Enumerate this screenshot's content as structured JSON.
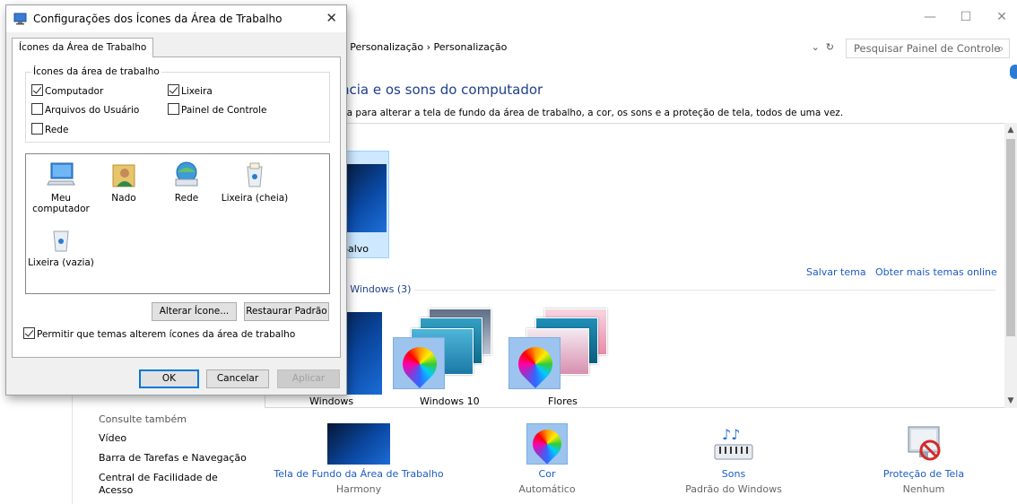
{
  "control_panel": {
    "breadcrumb_tail": "e Personalização  ›  Personalização",
    "search_placeholder": "Pesquisar Painel de Controle",
    "heading": "ncia e os sons do computador",
    "description": "na para alterar a tela de fundo da área de trabalho, a cor, os sons e a proteção de tela, todos de uma vez.",
    "saved_theme_label": "Salvo",
    "save_theme_link": "Salvar tema",
    "more_themes_link": "Obter mais temas online",
    "windows_section_label": "o Windows (3)",
    "themes": [
      "Windows",
      "Windows 10",
      "Flores"
    ],
    "see_also": {
      "title": "Consulte também",
      "items": [
        "Vídeo",
        "Barra de Tarefas e Navegação",
        "Central de Facilidade de",
        "Acesso"
      ]
    },
    "bottom_items": [
      {
        "title": "Tela de Fundo da Área de Trabalho",
        "subtitle": "Harmony"
      },
      {
        "title": "Cor",
        "subtitle": "Automático"
      },
      {
        "title": "Sons",
        "subtitle": "Padrão do Windows"
      },
      {
        "title": "Proteção de Tela",
        "subtitle": "Nenhum"
      }
    ]
  },
  "dialog": {
    "title": "Configurações dos Ícones da Área de Trabalho",
    "tab_label": "Ícones da Área de Trabalho",
    "group_label": "Ícones da área de trabalho",
    "checkboxes": {
      "computador": "Computador",
      "lixeira": "Lixeira",
      "arquivos_usuario": "Arquivos do Usuário",
      "painel_controle": "Painel de Controle",
      "rede": "Rede"
    },
    "icons": {
      "meu_computador_line1": "Meu",
      "meu_computador_line2": "computador",
      "nado": "Nado",
      "rede": "Rede",
      "lixeira_cheia": "Lixeira (cheia)",
      "lixeira_vazia": "Lixeira (vazia)"
    },
    "change_icon_button": "Alterar Ícone...",
    "restore_default_button": "Restaurar Padrão",
    "allow_themes_checkbox": "Permitir que temas alterem ícones da área de trabalho",
    "ok_button": "OK",
    "cancel_button": "Cancelar",
    "apply_button": "Aplicar"
  }
}
